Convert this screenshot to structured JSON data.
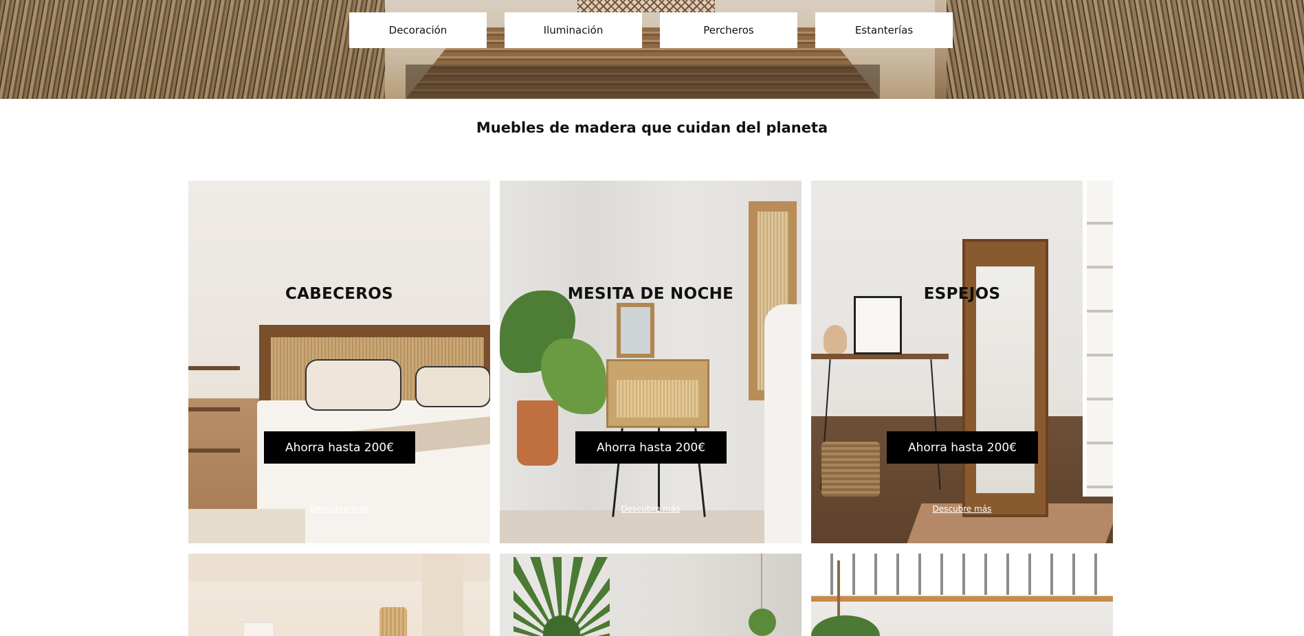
{
  "nav": {
    "items": [
      {
        "label": "Decoración"
      },
      {
        "label": "Iluminación"
      },
      {
        "label": "Percheros"
      },
      {
        "label": "Estanterías"
      }
    ]
  },
  "tagline": "Muebles de madera que cuidan del planeta",
  "cards": [
    {
      "title": "CABECEROS",
      "promo": "Ahorra hasta 200€",
      "link": "Descubre más"
    },
    {
      "title": "MESITA DE NOCHE",
      "promo": "Ahorra hasta 200€",
      "link": "Descubre más"
    },
    {
      "title": "ESPEJOS",
      "promo": "Ahorra hasta 200€",
      "link": "Descubre más"
    }
  ]
}
